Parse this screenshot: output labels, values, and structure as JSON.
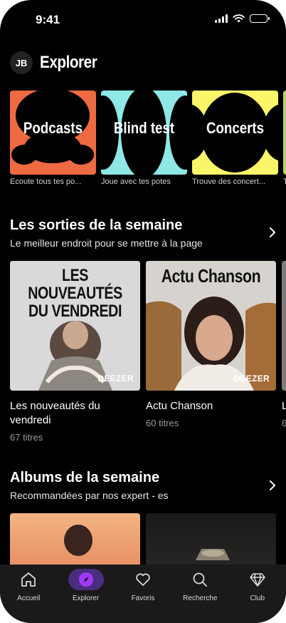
{
  "status_bar": {
    "time": "9:41"
  },
  "header": {
    "avatar_initials": "JB",
    "title": "Explorer"
  },
  "categories": [
    {
      "label": "Podcasts",
      "subtitle": "Ecoute tous tes po...",
      "bg": "#ee6a42"
    },
    {
      "label": "Blind test",
      "subtitle": "Joue avec tes potes",
      "bg": "#8de8e6"
    },
    {
      "label": "Concerts",
      "subtitle": "Trouve des concert...",
      "bg": "#fbf569"
    },
    {
      "label": "",
      "subtitle": "T",
      "bg": "#b7d26a"
    }
  ],
  "section_new": {
    "title": "Les sorties de la semaine",
    "subtitle": "Le meilleur endroit pour se mettre à la page",
    "cards": [
      {
        "cover_title": "LES NOUVEAUTÉS DU VENDREDI",
        "brand": "DEEZER",
        "name": "Les nouveautés du vendredi",
        "count": "67 titres"
      },
      {
        "cover_title": "Actu Chanson",
        "brand": "DEEZER",
        "name": "Actu Chanson",
        "count": "60 titres"
      },
      {
        "name": "L",
        "count": "6"
      }
    ]
  },
  "section_albums": {
    "title": "Albums de la semaine",
    "subtitle": "Recommandées par nos expert - es"
  },
  "nav": [
    {
      "label": "Accueil",
      "icon": "home-icon"
    },
    {
      "label": "Explorer",
      "icon": "compass-icon",
      "active": true
    },
    {
      "label": "Favoris",
      "icon": "heart-icon"
    },
    {
      "label": "Recherche",
      "icon": "search-icon"
    },
    {
      "label": "Club",
      "icon": "diamond-icon"
    }
  ],
  "colors": {
    "accent": "#a238ff",
    "nav_active_bg": "#4a2d7f",
    "background": "#000000"
  }
}
